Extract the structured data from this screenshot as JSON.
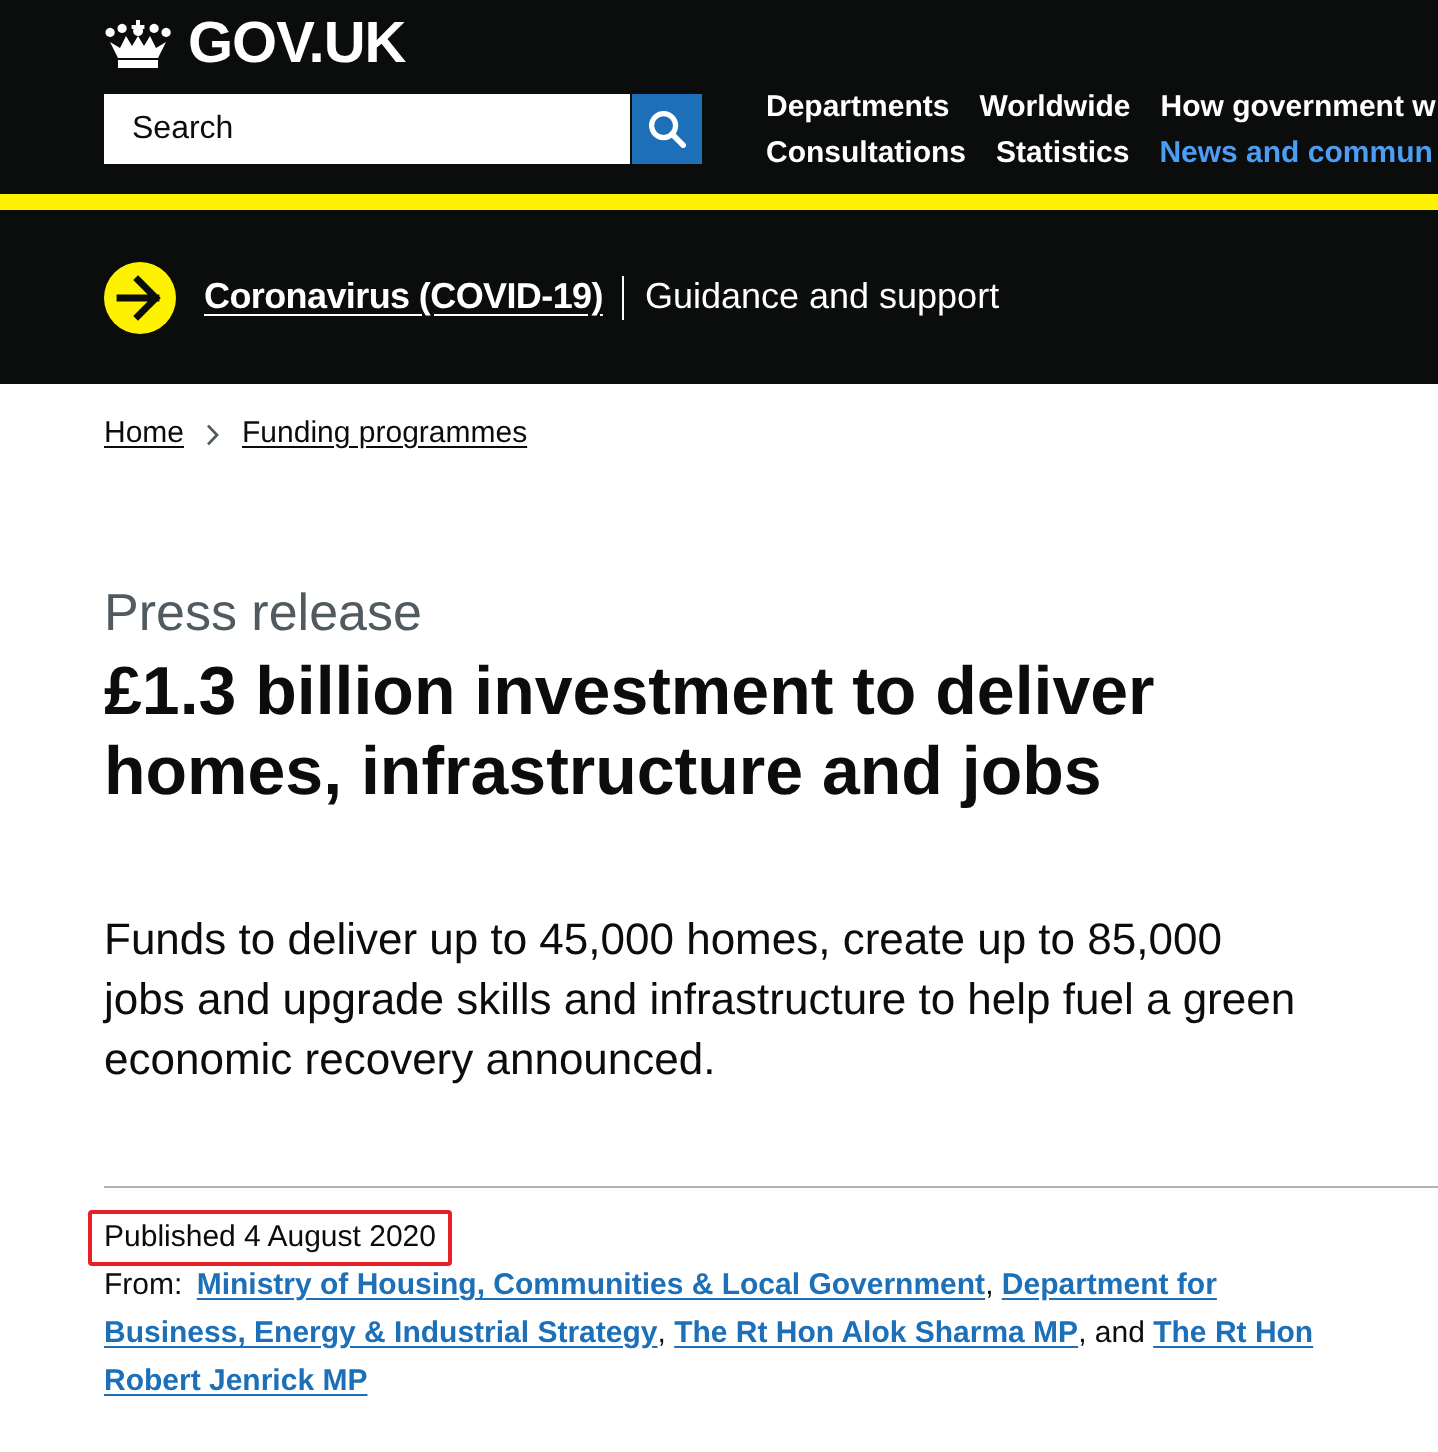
{
  "header": {
    "logo": "GOV.UK",
    "search": {
      "placeholder": "Search"
    },
    "nav_rows": [
      [
        {
          "label": "Departments",
          "selected": false
        },
        {
          "label": "Worldwide",
          "selected": false
        },
        {
          "label": "How government w",
          "selected": false
        }
      ],
      [
        {
          "label": "Consultations",
          "selected": false
        },
        {
          "label": "Statistics",
          "selected": false
        },
        {
          "label": "News and commun",
          "selected": true
        }
      ]
    ]
  },
  "banner": {
    "link": "Coronavirus (COVID-19)",
    "text": "Guidance and support"
  },
  "breadcrumbs": [
    {
      "label": "Home"
    },
    {
      "label": "Funding programmes"
    }
  ],
  "article": {
    "type": "Press release",
    "title": "£1.3 billion investment to deliver homes, infrastructure and jobs",
    "lede_lines": [
      "Funds to deliver up to 45,000 homes, create up to 85,000",
      "jobs and upgrade skills and infrastructure to help fuel a green",
      "economic recovery announced."
    ],
    "published": {
      "text": "Published 4 August 2020",
      "highlighted": true
    },
    "from_lines": [
      [
        {
          "kind": "label",
          "text": "From:"
        },
        {
          "kind": "link",
          "text": "Ministry of Housing, Communities & Local Government"
        },
        {
          "kind": "separator",
          "text": ","
        },
        {
          "kind": "link",
          "text": "Department for"
        }
      ],
      [
        {
          "kind": "link",
          "text": "Business, Energy & Industrial Strategy"
        },
        {
          "kind": "separator",
          "text": ","
        },
        {
          "kind": "link",
          "text": "The Rt Hon Alok Sharma MP"
        },
        {
          "kind": "separator",
          "text": ", and"
        },
        {
          "kind": "link",
          "text": "The Rt Hon"
        }
      ],
      [
        {
          "kind": "link",
          "text": "Robert Jenrick MP"
        }
      ]
    ]
  }
}
